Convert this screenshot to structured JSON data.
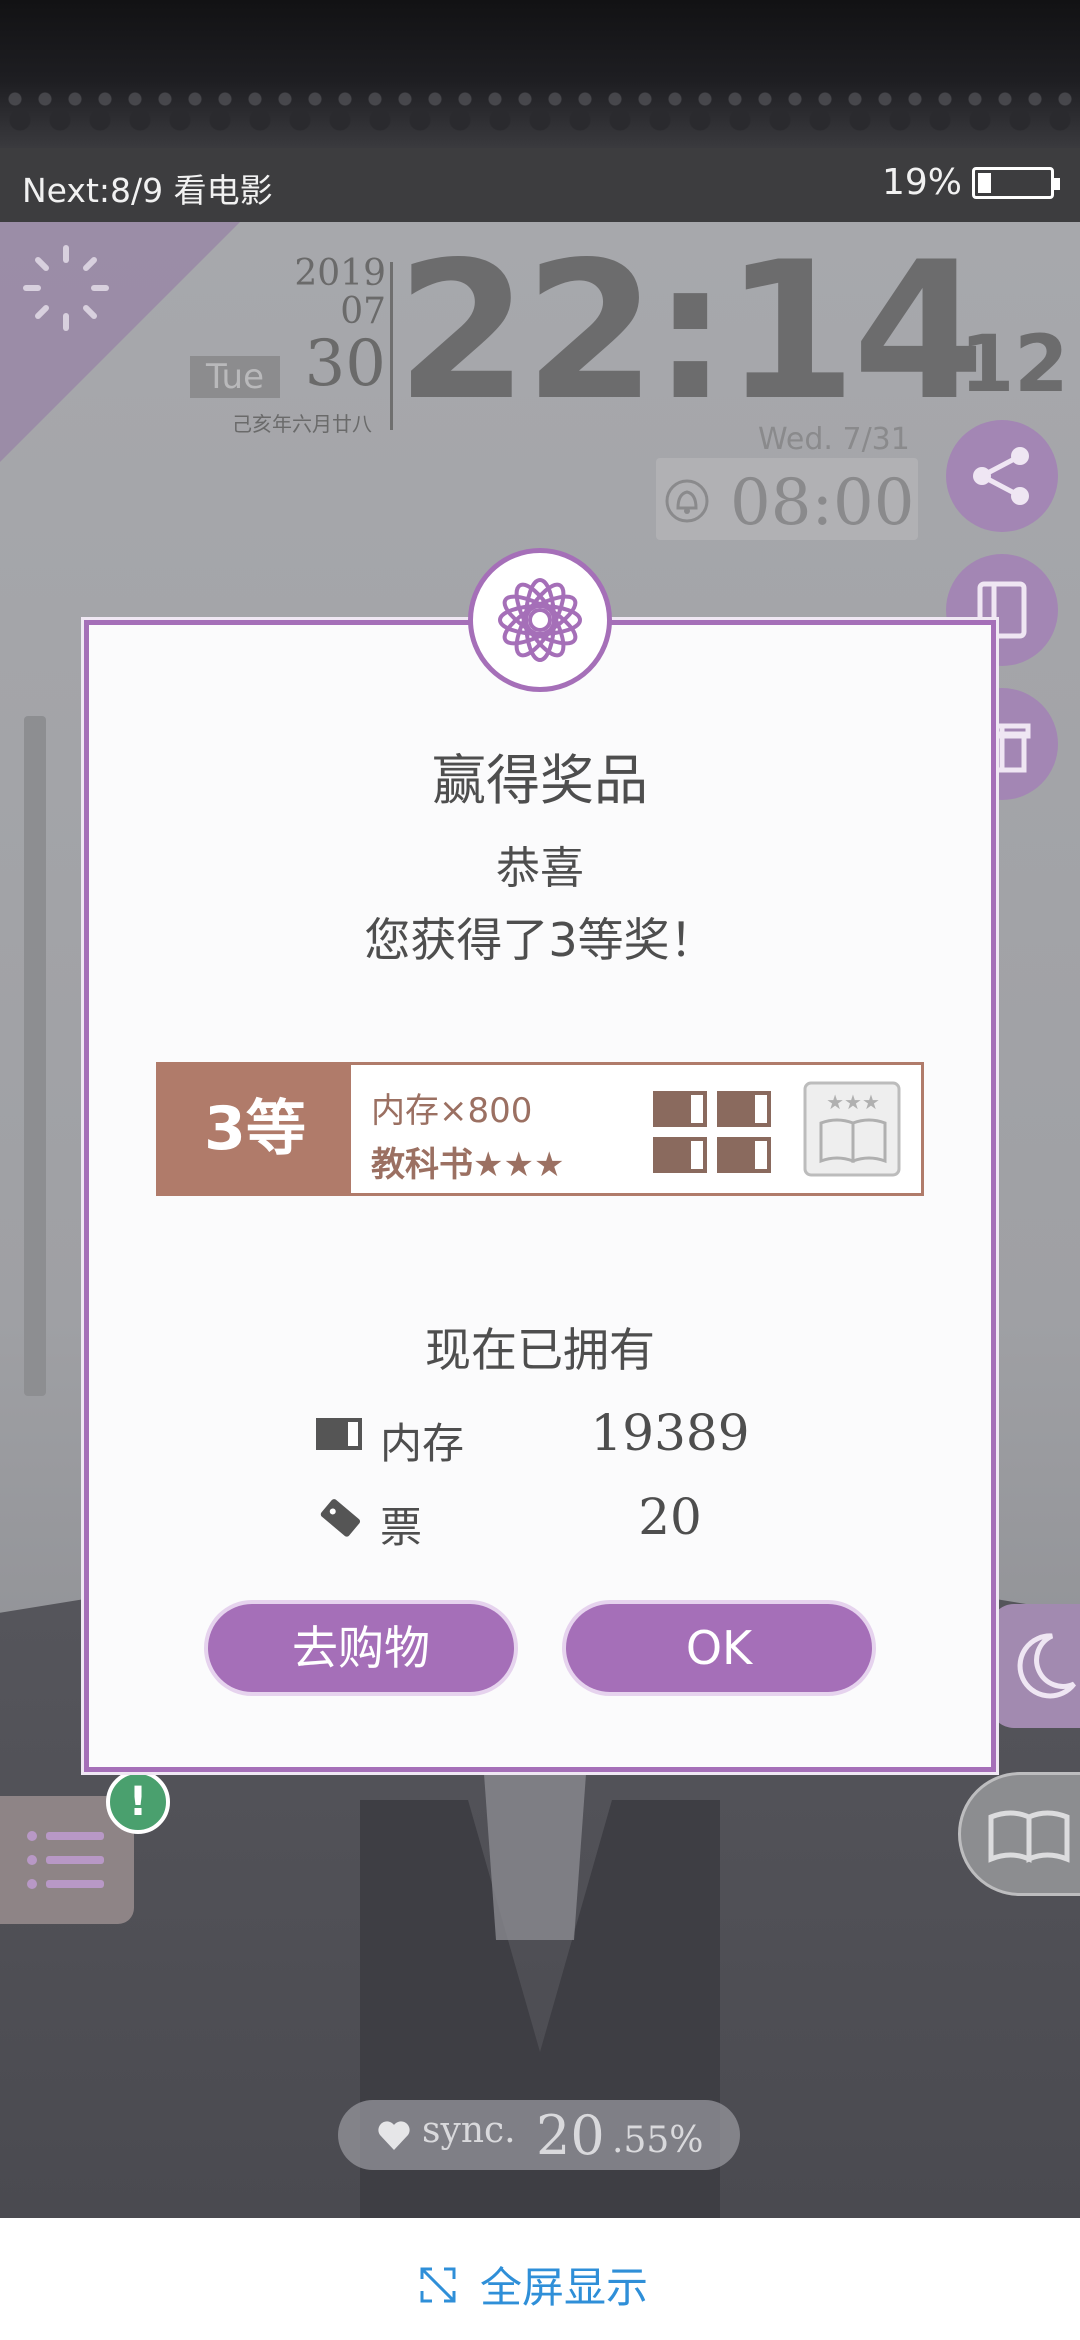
{
  "statusbar": {
    "next_text": "Next:8/9 看电影",
    "battery_text": "19%",
    "battery_level": 0.19
  },
  "clock": {
    "year": "2019",
    "month": "07",
    "day": "30",
    "weekday": "Tue",
    "lunar": "己亥年六月廿八",
    "time": "22:14",
    "seconds": "12",
    "alarm_date": "Wed.  7/31",
    "alarm_time": "08:00"
  },
  "dialog": {
    "title": "赢得奖品",
    "congrats": "恭喜",
    "message": "您获得了3等奖！",
    "prize": {
      "rank": "3等",
      "item1": "内存×800",
      "item2": "教科书★★★"
    },
    "owned_title": "现在已拥有",
    "owned": [
      {
        "icon": "memory-card-icon",
        "label": "内存",
        "value": "19389"
      },
      {
        "icon": "ticket-icon",
        "label": "票",
        "value": "20"
      }
    ],
    "shop_button": "去购物",
    "ok_button": "OK"
  },
  "sync": {
    "label": "sync.",
    "value_int": "20",
    "value_dec": ".55%"
  },
  "bottom": {
    "fullscreen_label": "全屏显示"
  },
  "colors": {
    "accent": "#a56fb8",
    "prize": "#b07b6a",
    "link": "#2f8fd8"
  }
}
